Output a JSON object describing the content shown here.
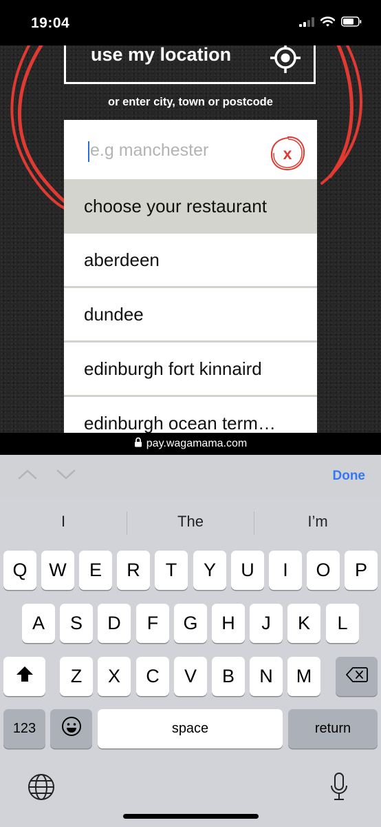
{
  "status_bar": {
    "time": "19:04"
  },
  "page": {
    "use_location_label": "use my location",
    "or_text": "or enter city, town or postcode",
    "search": {
      "placeholder": "e.g manchester",
      "value": ""
    },
    "clear_label": "x",
    "dropdown_header": "choose your restaurant",
    "restaurants": [
      "aberdeen",
      "dundee",
      "edinburgh fort kinnaird",
      "edinburgh ocean term…"
    ]
  },
  "url_bar": {
    "domain": "pay.wagamama.com"
  },
  "keyboard_accessory": {
    "done_label": "Done"
  },
  "keyboard": {
    "predictions": [
      "I",
      "The",
      "I’m"
    ],
    "row1": [
      "Q",
      "W",
      "E",
      "R",
      "T",
      "Y",
      "U",
      "I",
      "O",
      "P"
    ],
    "row2": [
      "A",
      "S",
      "D",
      "F",
      "G",
      "H",
      "J",
      "K",
      "L"
    ],
    "row3": [
      "Z",
      "X",
      "C",
      "V",
      "B",
      "N",
      "M"
    ],
    "numbers_label": "123",
    "space_label": "space",
    "return_label": "return"
  },
  "colors": {
    "brand_red": "#e03a32",
    "ios_blue": "#3478f6",
    "dropdown_header_bg": "#d4d4ce"
  }
}
